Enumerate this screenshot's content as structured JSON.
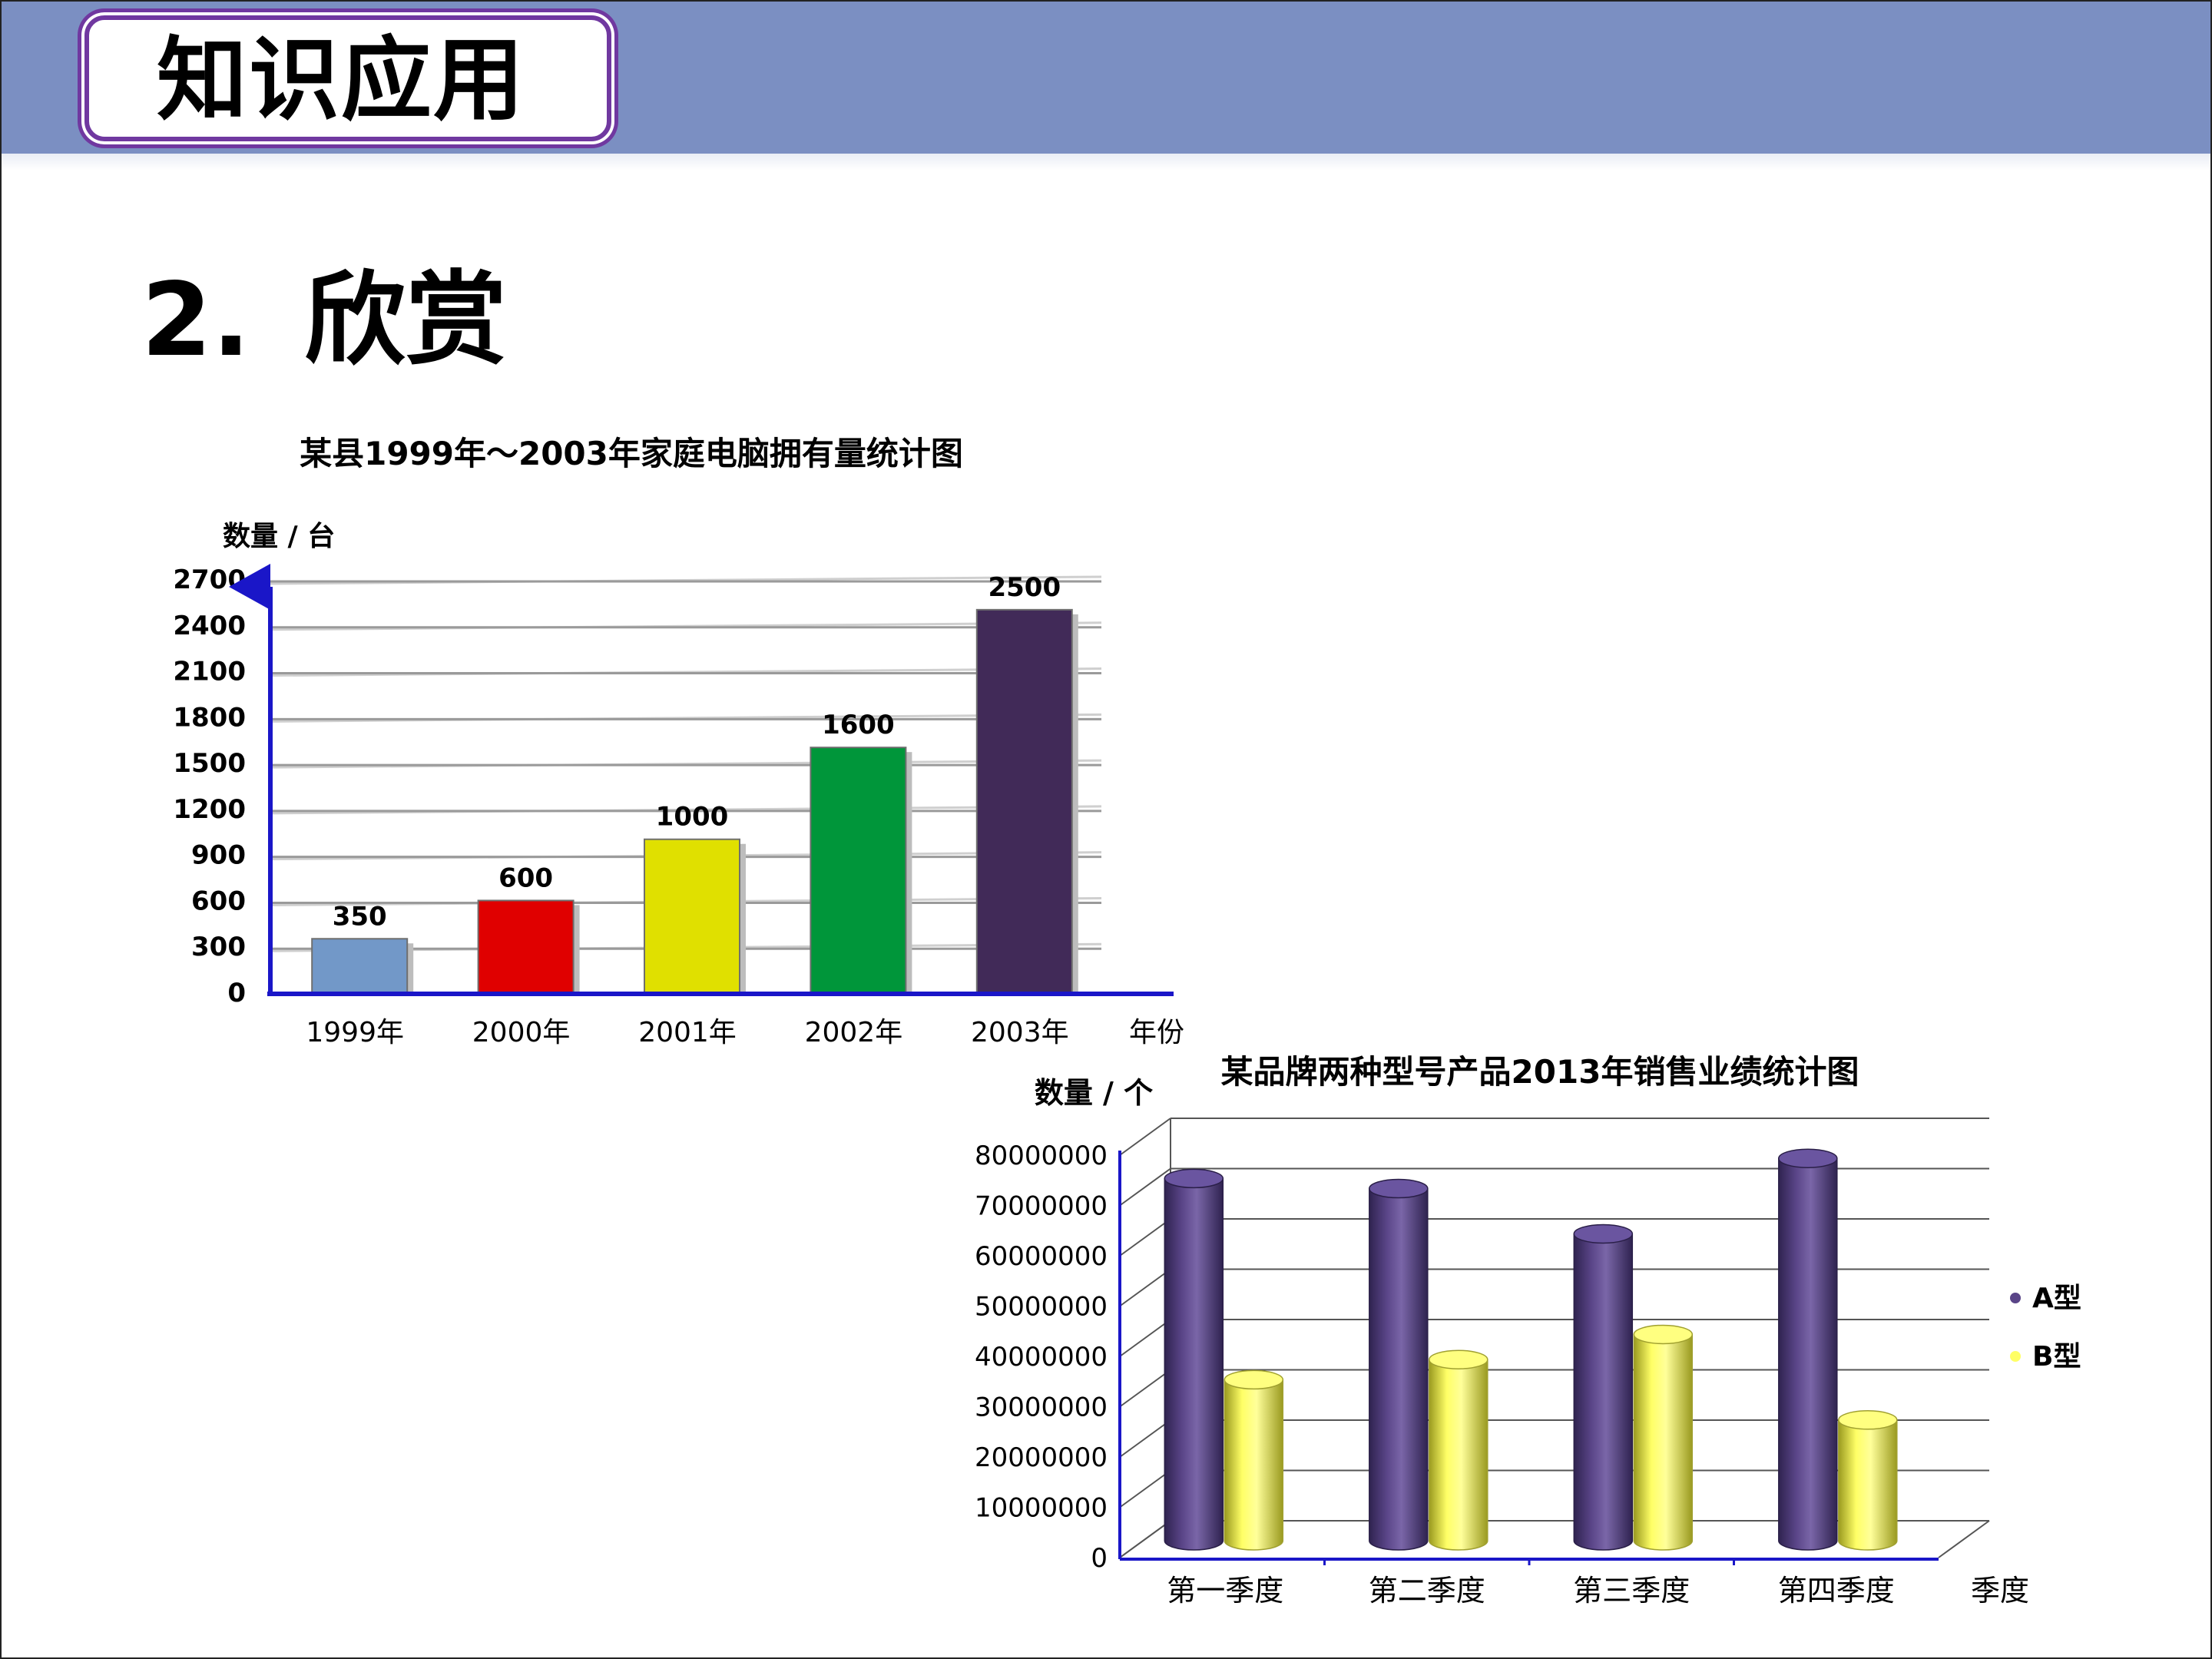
{
  "header": {
    "title": "知识应用"
  },
  "section": {
    "number": "2.",
    "title": "欣赏"
  },
  "colors": {
    "banner": "#7b8fc2",
    "frame": "#7038a0",
    "axis": "#1a16c8"
  },
  "chart_data": [
    {
      "type": "bar",
      "title": "某县1999年～2003年家庭电脑拥有量统计图",
      "ylabel": "数量 / 台",
      "xlabel": "年份",
      "categories": [
        "1999年",
        "2000年",
        "2001年",
        "2002年",
        "2003年"
      ],
      "values": [
        350,
        600,
        1000,
        1600,
        2500
      ],
      "colors": [
        "#7298c8",
        "#e00000",
        "#e0e000",
        "#00963a",
        "#412a58"
      ],
      "data_labels": [
        "350",
        "600",
        "1000",
        "1600",
        "2500"
      ],
      "ylim": [
        0,
        2700
      ],
      "yticks": [
        "0",
        "300",
        "600",
        "900",
        "1200",
        "1500",
        "1800",
        "2100",
        "2400",
        "2700"
      ],
      "grid": true
    },
    {
      "type": "bar",
      "style": "3d-cylinder",
      "title": "某品牌两种型号产品2013年销售业绩统计图",
      "ylabel": "数量 / 个",
      "xlabel": "季度",
      "categories": [
        "第一季度",
        "第二季度",
        "第三季度",
        "第四季度"
      ],
      "series": [
        {
          "name": "A型",
          "values": [
            72000000,
            70000000,
            61000000,
            76000000
          ],
          "color": "#5a4588"
        },
        {
          "name": "B型",
          "values": [
            32000000,
            36000000,
            41000000,
            24000000
          ],
          "color": "#ffff66"
        }
      ],
      "ylim": [
        0,
        80000000
      ],
      "yticks": [
        "0",
        "10000000",
        "20000000",
        "30000000",
        "40000000",
        "50000000",
        "60000000",
        "70000000",
        "80000000"
      ],
      "legend": "right",
      "grid": true
    }
  ]
}
